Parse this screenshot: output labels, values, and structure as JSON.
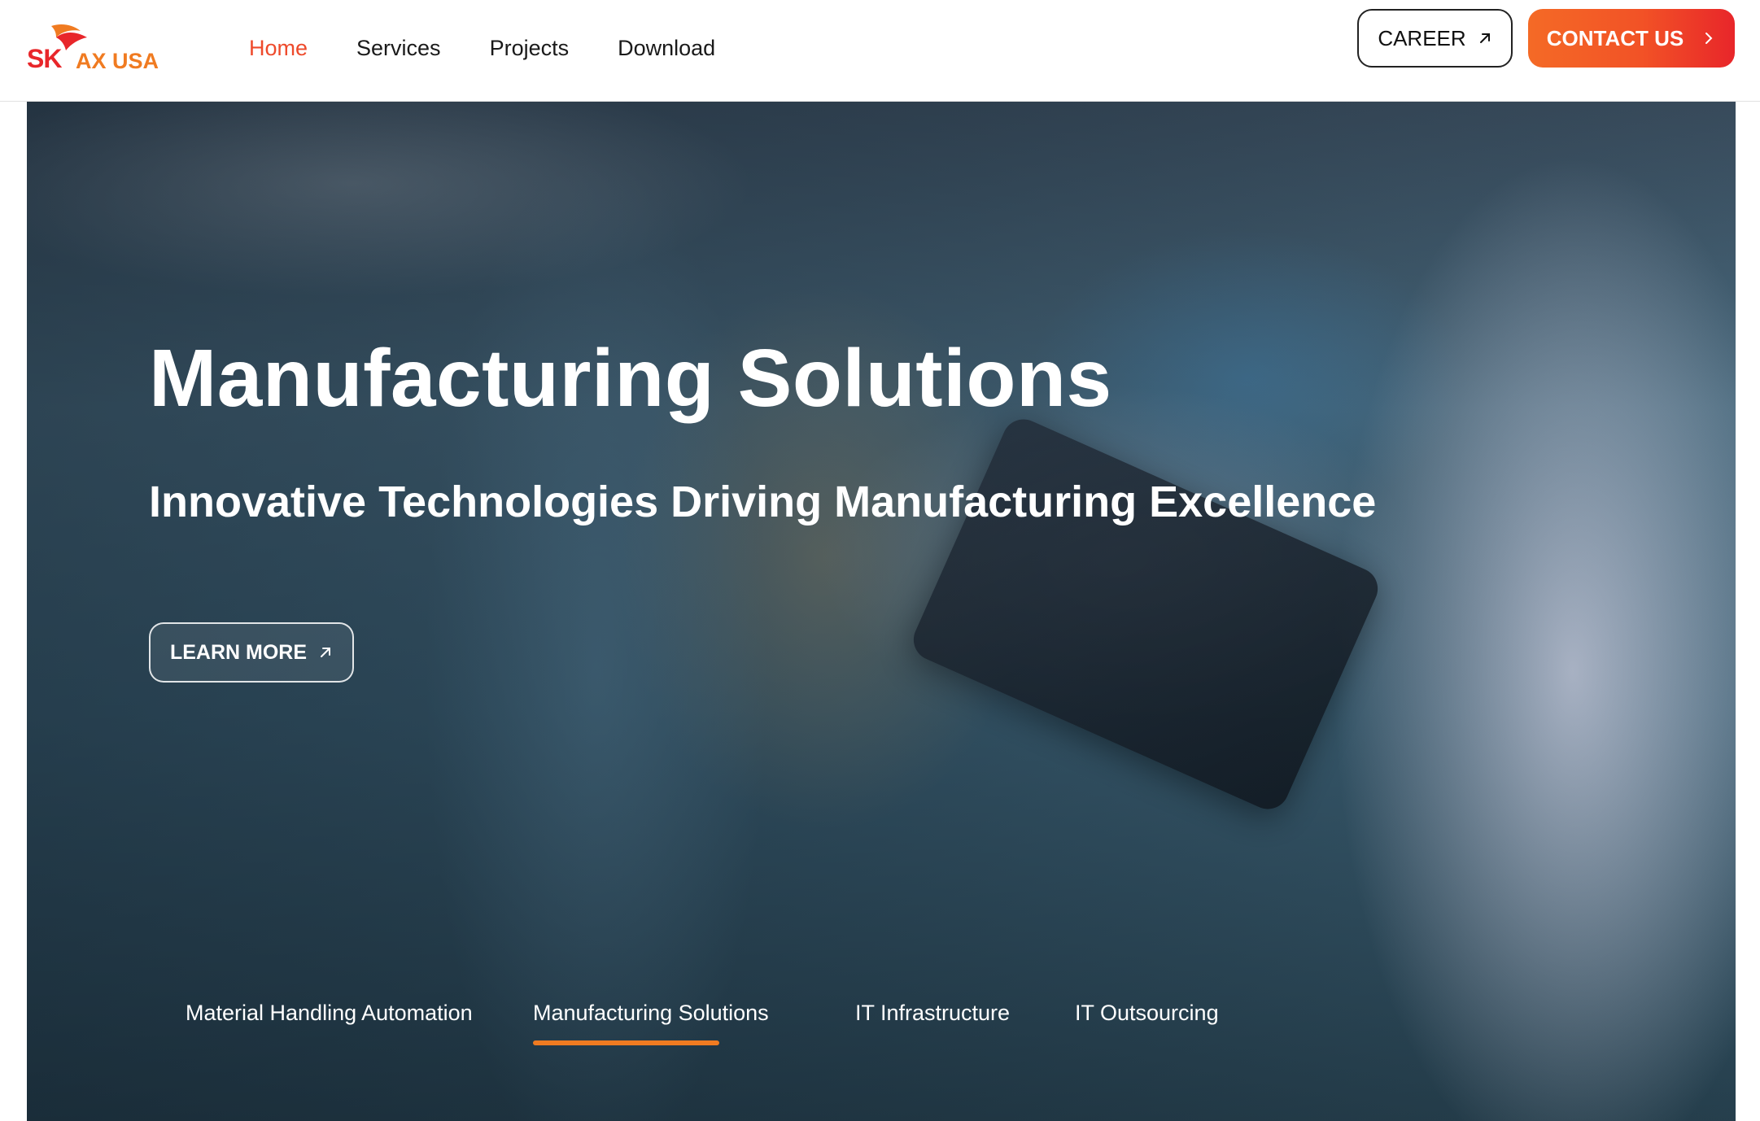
{
  "header": {
    "logo": {
      "sk": "SK",
      "suffix": "AX USA"
    },
    "nav": [
      {
        "label": "Home",
        "active": true
      },
      {
        "label": "Services",
        "active": false
      },
      {
        "label": "Projects",
        "active": false
      },
      {
        "label": "Download",
        "active": false
      }
    ],
    "career_label": "CAREER",
    "contact_label": "CONTACT US"
  },
  "hero": {
    "title": "Manufacturing Solutions",
    "subtitle": "Innovative Technologies Driving Manufacturing Excellence",
    "cta_label": "LEARN MORE",
    "tabs": [
      {
        "label": "Material Handling Automation",
        "active": false
      },
      {
        "label": "Manufacturing Solutions",
        "active": true
      },
      {
        "label": "IT Infrastructure",
        "active": false
      },
      {
        "label": "IT Outsourcing",
        "active": false
      }
    ]
  },
  "colors": {
    "accent_orange": "#f07b21",
    "accent_red": "#e8262a",
    "nav_active": "#ee4a2b"
  },
  "icons": [
    "sk-wing-logo-icon",
    "arrow-up-right-icon",
    "chevron-right-icon"
  ]
}
